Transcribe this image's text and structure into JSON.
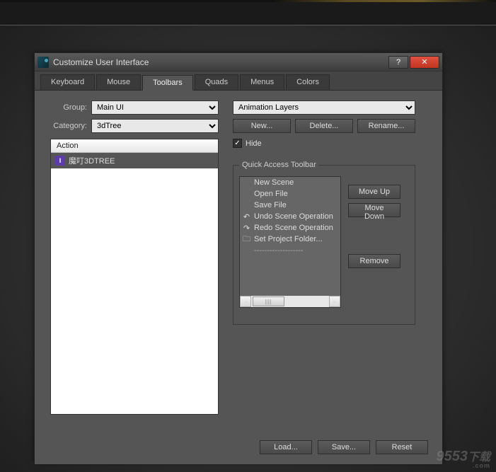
{
  "window": {
    "title": "Customize User Interface"
  },
  "tabs": [
    "Keyboard",
    "Mouse",
    "Toolbars",
    "Quads",
    "Menus",
    "Colors"
  ],
  "activeTab": "Toolbars",
  "left": {
    "groupLabel": "Group:",
    "groupValue": "Main UI",
    "categoryLabel": "Category:",
    "categoryValue": "3dTree",
    "actionHeader": "Action",
    "actions": [
      {
        "icon": "I",
        "label": "魔叮3DTREE"
      }
    ]
  },
  "right": {
    "topSelect": "Animation Layers",
    "newBtn": "New...",
    "deleteBtn": "Delete...",
    "renameBtn": "Rename...",
    "hideChecked": true,
    "hideLabel": "Hide",
    "qatLegend": "Quick Access Toolbar",
    "qatItems": [
      {
        "label": "New Scene"
      },
      {
        "label": "Open File"
      },
      {
        "label": "Save File"
      },
      {
        "icon": "undo",
        "label": "Undo Scene Operation"
      },
      {
        "icon": "redo",
        "label": "Redo Scene Operation"
      },
      {
        "icon": "folder",
        "label": "Set Project Folder..."
      },
      {
        "sep": true,
        "label": "-------------------"
      }
    ],
    "moveUp": "Move Up",
    "moveDown": "Move Down",
    "remove": "Remove"
  },
  "bottom": {
    "load": "Load...",
    "save": "Save...",
    "reset": "Reset"
  },
  "watermark": {
    "main": "9553",
    "sub": "下载",
    "tld": ".com"
  }
}
